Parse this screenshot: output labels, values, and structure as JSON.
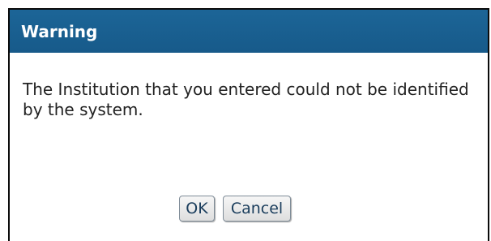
{
  "dialog": {
    "title": "Warning",
    "message": "The Institution that you entered could not be identified by the system.",
    "ok_label": "OK",
    "cancel_label": "Cancel"
  },
  "colors": {
    "title_bar": "#1a6193",
    "title_text": "#ffffff"
  }
}
